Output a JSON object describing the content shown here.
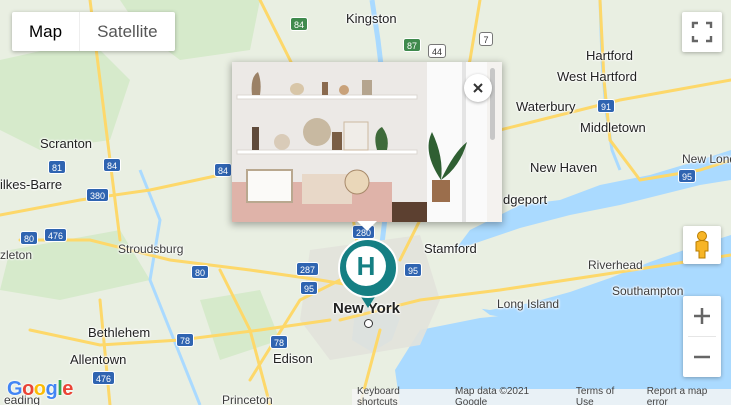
{
  "map_type": {
    "options": [
      {
        "label": "Map",
        "active": true
      },
      {
        "label": "Satellite",
        "active": false
      }
    ]
  },
  "places": [
    {
      "key": "kingston",
      "label": "Kingston"
    },
    {
      "key": "hartford",
      "label": "Hartford"
    },
    {
      "key": "west_hartford",
      "label": "West Hartford"
    },
    {
      "key": "waterbury",
      "label": "Waterbury"
    },
    {
      "key": "middletown",
      "label": "Middletown"
    },
    {
      "key": "scranton",
      "label": "Scranton"
    },
    {
      "key": "wilkes_barre",
      "label": "ilkes-Barre"
    },
    {
      "key": "new_haven",
      "label": "New Haven"
    },
    {
      "key": "new_london",
      "label": "New Lond"
    },
    {
      "key": "bridgeport",
      "label": "dgeport"
    },
    {
      "key": "stamford",
      "label": "Stamford"
    },
    {
      "key": "stroudsburg",
      "label": "Stroudsburg"
    },
    {
      "key": "riverhead",
      "label": "Riverhead"
    },
    {
      "key": "southampton",
      "label": "Southampton"
    },
    {
      "key": "long_island",
      "label": "Long Island"
    },
    {
      "key": "new_york",
      "label": "New York"
    },
    {
      "key": "bethlehem",
      "label": "Bethlehem"
    },
    {
      "key": "allentown",
      "label": "Allentown"
    },
    {
      "key": "edison",
      "label": "Edison"
    },
    {
      "key": "princeton",
      "label": "Princeton"
    },
    {
      "key": "reading",
      "label": "eading"
    },
    {
      "key": "zleton",
      "label": "zleton"
    }
  ],
  "road_shields": [
    "84",
    "87",
    "7",
    "44",
    "81",
    "84",
    "380",
    "84",
    "91",
    "95",
    "476",
    "80",
    "280",
    "287",
    "80",
    "95",
    "78",
    "78",
    "476",
    "95"
  ],
  "popup": {
    "close_icon": "close-icon",
    "image_alt": "Interior with shelves and plants"
  },
  "marker": {
    "letter": "H",
    "color": "#157f83"
  },
  "controls": {
    "fullscreen_icon": "fullscreen-icon",
    "pegman_icon": "pegman-icon",
    "zoom_in_label": "+",
    "zoom_out_label": "−"
  },
  "logo": {
    "letters": [
      "G",
      "o",
      "o",
      "g",
      "l",
      "e"
    ]
  },
  "footer": {
    "keyboard_shortcuts": "Keyboard shortcuts",
    "map_data": "Map data ©2021 Google",
    "terms": "Terms of Use",
    "report": "Report a map error"
  },
  "colors": {
    "water": "#aadaff",
    "land": "#e9efe2",
    "highway": "#fdd86a",
    "park": "#c8e6c0",
    "marker": "#157f83"
  }
}
